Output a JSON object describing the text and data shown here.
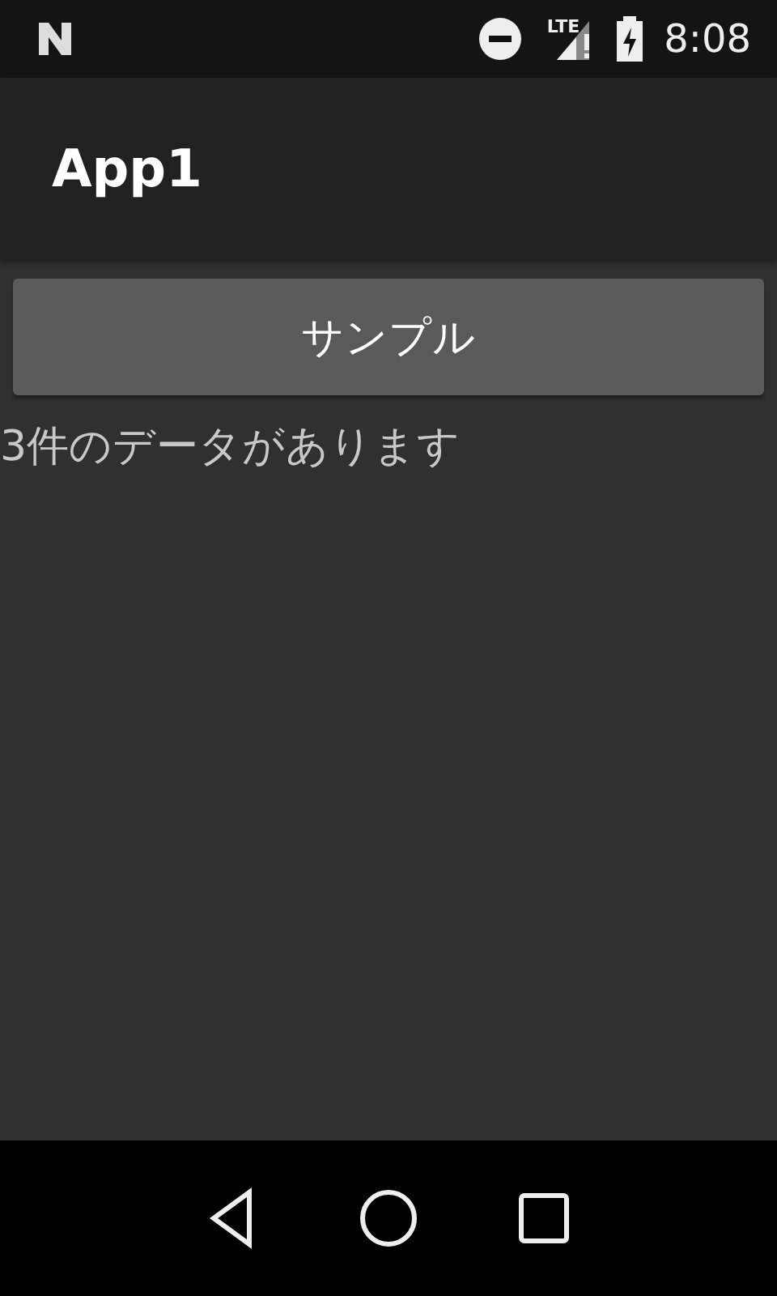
{
  "status_bar": {
    "network": "LTE",
    "time": "8:08"
  },
  "app_bar": {
    "title": "App1"
  },
  "button": {
    "label": "サンプル"
  },
  "message": "3件のデータがあります"
}
